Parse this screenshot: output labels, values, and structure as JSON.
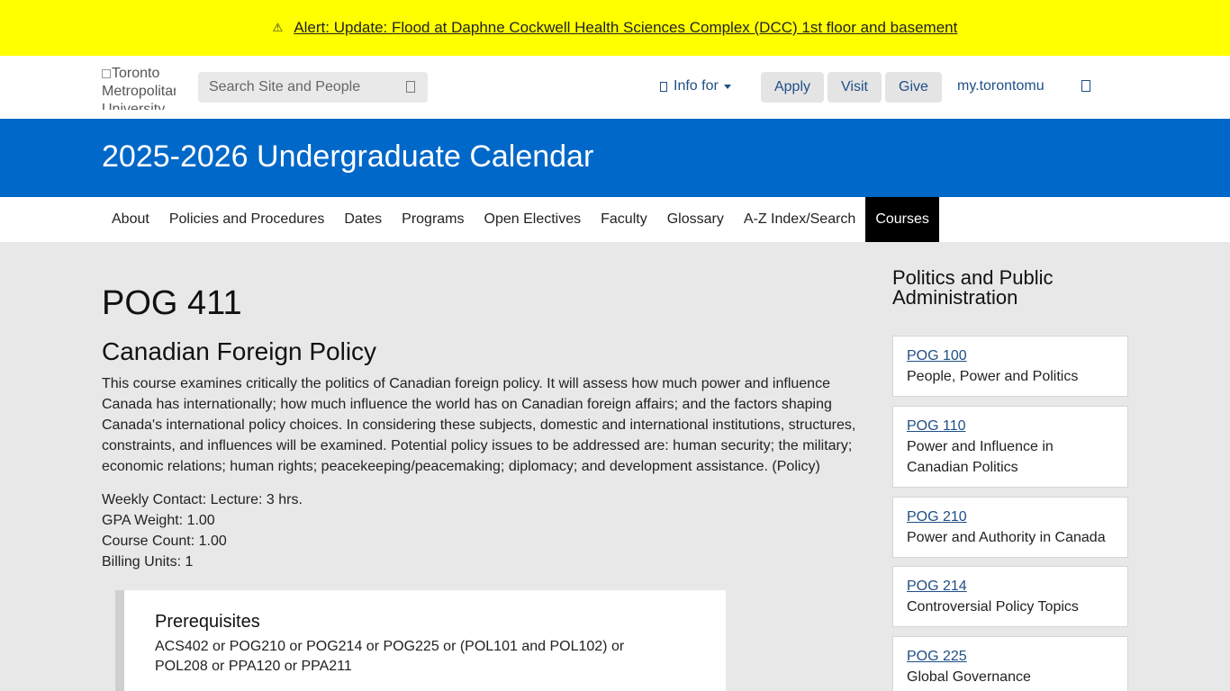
{
  "alert": {
    "icon": "warning-icon",
    "text": "Alert: Update: Flood at Daphne Cockwell Health Sciences Complex (DCC) 1st floor and basement"
  },
  "header": {
    "logo_alt": "Toronto Metropolitan University",
    "search_placeholder": "Search Site and People",
    "info_for": "Info for",
    "buttons": {
      "apply": "Apply",
      "visit": "Visit",
      "give": "Give"
    },
    "my_link": "my.torontomu"
  },
  "banner": {
    "title": "2025-2026 Undergraduate Calendar"
  },
  "nav": {
    "items": [
      "About",
      "Policies and Procedures",
      "Dates",
      "Programs",
      "Open Electives",
      "Faculty",
      "Glossary",
      "A-Z Index/Search",
      "Courses"
    ],
    "active": "Courses"
  },
  "course": {
    "code": "POG 411",
    "title": "Canadian Foreign Policy",
    "description": "This course examines critically the politics of Canadian foreign policy. It will assess how much power and influence Canada has internationally; how much influence the world has on Canadian foreign affairs; and the factors shaping Canada's international policy choices. In considering these subjects, domestic and international institutions, structures, constraints, and influences will be examined. Potential policy issues to be addressed are: human security; the military; economic relations; human rights; peacekeeping/peacemaking; diplomacy; and development assistance. (Policy)",
    "weekly_contact": "Weekly Contact: Lecture: 3 hrs.",
    "gpa_weight": "GPA Weight: 1.00",
    "course_count": "Course Count: 1.00",
    "billing_units": "Billing Units: 1",
    "prereq_heading": "Prerequisites",
    "prereq_text": "ACS402 or POG210 or POG214 or POG225 or (POL101 and POL102) or POL208 or PPA120 or PPA211"
  },
  "sidebar": {
    "title": "Politics and Public Administration",
    "courses": [
      {
        "code": "POG 100",
        "name": "People, Power and Politics"
      },
      {
        "code": "POG 110",
        "name": "Power and Influence in Canadian Politics"
      },
      {
        "code": "POG 210",
        "name": "Power and Authority in Canada"
      },
      {
        "code": "POG 214",
        "name": "Controversial Policy Topics"
      },
      {
        "code": "POG 225",
        "name": "Global Governance"
      }
    ]
  }
}
